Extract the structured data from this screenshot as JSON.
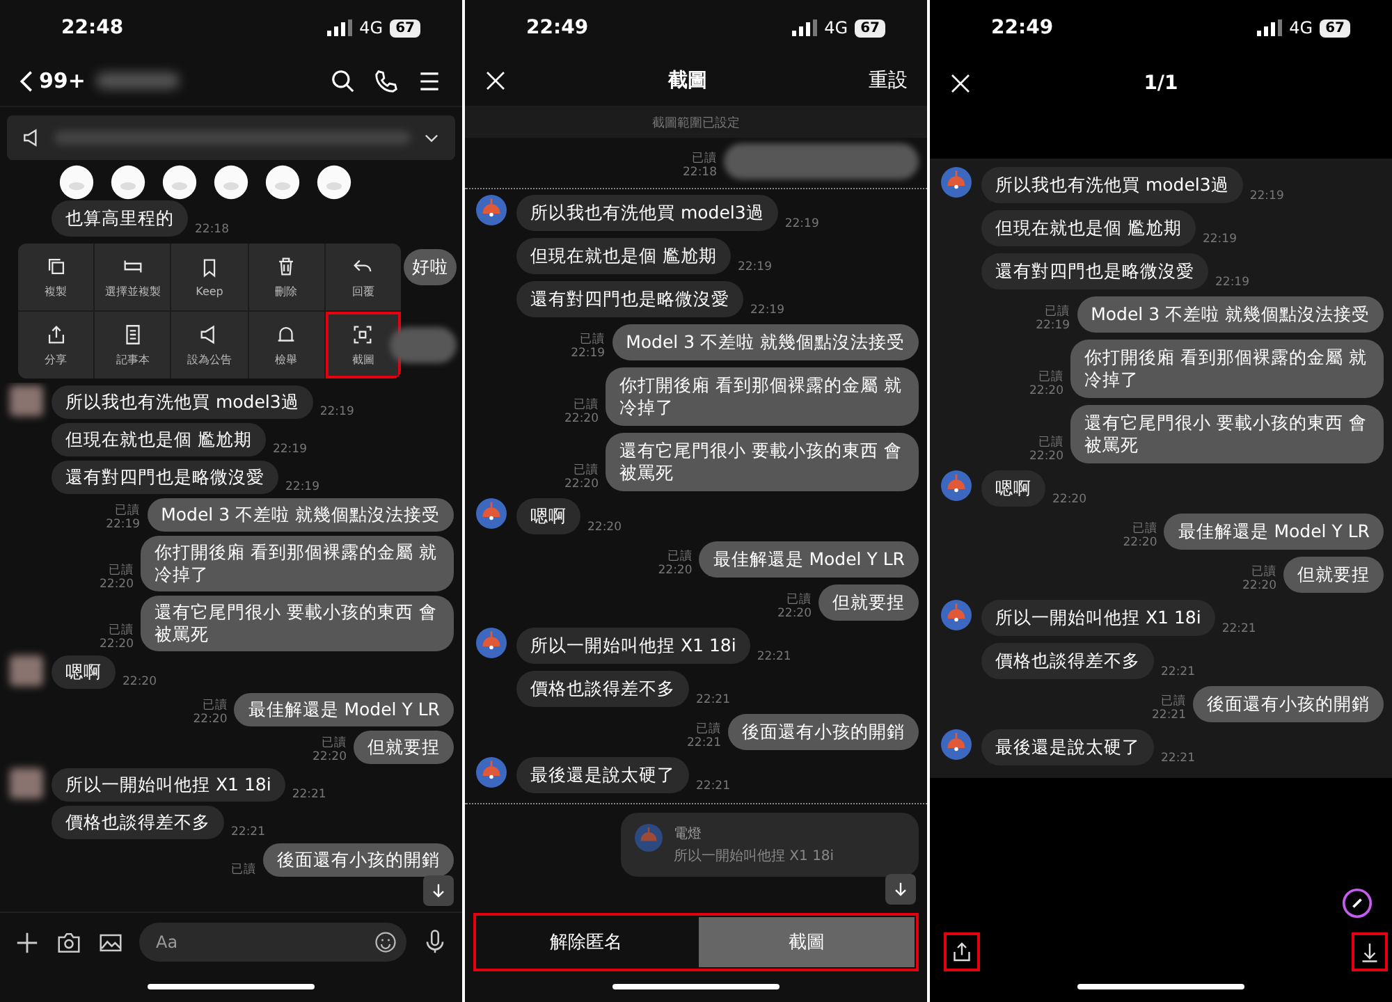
{
  "screens": [
    {
      "kind": "chat",
      "status": {
        "time": "22:48",
        "network": "4G",
        "battery": "67"
      },
      "header": {
        "unread": "99+"
      },
      "context_message": {
        "text": "也算高里程的",
        "time": "22:18"
      },
      "behind_menu": [
        {
          "kind": "out",
          "text": "好啦"
        },
        {
          "kind": "blurred"
        }
      ],
      "menu": [
        {
          "kind": "copy",
          "label": "複製",
          "highlighted": false
        },
        {
          "kind": "select_copy",
          "label": "選擇並複製",
          "highlighted": false
        },
        {
          "kind": "keep",
          "label": "Keep",
          "highlighted": false
        },
        {
          "kind": "delete",
          "label": "刪除",
          "highlighted": false
        },
        {
          "kind": "reply",
          "label": "回覆",
          "highlighted": false
        },
        {
          "kind": "share",
          "label": "分享",
          "highlighted": false
        },
        {
          "kind": "notes",
          "label": "記事本",
          "highlighted": false
        },
        {
          "kind": "announce",
          "label": "設為公告",
          "highlighted": false
        },
        {
          "kind": "report",
          "label": "檢舉",
          "highlighted": false
        },
        {
          "kind": "capture",
          "label": "截圖",
          "highlighted": true
        }
      ],
      "messages": [
        {
          "kind": "in",
          "avatar": true,
          "text": "所以我也有洗他買 model3過",
          "time": "22:19"
        },
        {
          "kind": "in",
          "text": "但現在就也是個 尷尬期",
          "time": "22:19"
        },
        {
          "kind": "in",
          "text": "還有對四門也是略微沒愛",
          "time": "22:19"
        },
        {
          "kind": "out",
          "text": "Model 3 不差啦 就幾個點沒法接受",
          "read": "已讀",
          "time": "22:19"
        },
        {
          "kind": "out",
          "text": "你打開後廂 看到那個裸露的金屬 就冷掉了",
          "read": "已讀",
          "time": "22:20"
        },
        {
          "kind": "out",
          "text": "還有它尾門很小 要載小孩的東西 會被罵死",
          "read": "已讀",
          "time": "22:20"
        },
        {
          "kind": "in",
          "avatar": true,
          "text": "嗯啊",
          "time": "22:20"
        },
        {
          "kind": "out",
          "text": "最佳解還是 Model Y LR",
          "read": "已讀",
          "time": "22:20"
        },
        {
          "kind": "out",
          "text": "但就要捏",
          "read": "已讀",
          "time": "22:20"
        },
        {
          "kind": "in",
          "avatar": true,
          "text": "所以一開始叫他捏 X1 18i",
          "time": "22:21"
        },
        {
          "kind": "in",
          "text": "價格也談得差不多",
          "time": "22:21"
        },
        {
          "kind": "out",
          "text": "後面還有小孩的開銷",
          "read": "已讀"
        }
      ],
      "input": {
        "placeholder": "Aa"
      }
    },
    {
      "kind": "capture",
      "status": {
        "time": "22:49",
        "network": "4G",
        "battery": "67"
      },
      "header": {
        "title": "截圖",
        "action": "重設"
      },
      "notice": "截圖範圍已設定",
      "pre_messages": [
        {
          "kind": "blurred",
          "read": "已讀",
          "time": "22:18"
        }
      ],
      "messages": [
        {
          "kind": "in",
          "avatar": true,
          "text": "所以我也有洗他買 model3過",
          "time": "22:19"
        },
        {
          "kind": "in",
          "text": "但現在就也是個 尷尬期",
          "time": "22:19"
        },
        {
          "kind": "in",
          "text": "還有對四門也是略微沒愛",
          "time": "22:19"
        },
        {
          "kind": "out",
          "text": "Model 3 不差啦 就幾個點沒法接受",
          "read": "已讀",
          "time": "22:19"
        },
        {
          "kind": "out",
          "text": "你打開後廂 看到那個裸露的金屬 就冷掉了",
          "read": "已讀",
          "time": "22:20"
        },
        {
          "kind": "out",
          "text": "還有它尾門很小 要載小孩的東西 會被罵死",
          "read": "已讀",
          "time": "22:20"
        },
        {
          "kind": "in",
          "avatar": true,
          "text": "嗯啊",
          "time": "22:20"
        },
        {
          "kind": "out",
          "text": "最佳解還是 Model Y LR",
          "read": "已讀",
          "time": "22:20"
        },
        {
          "kind": "out",
          "text": "但就要捏",
          "read": "已讀",
          "time": "22:20"
        },
        {
          "kind": "in",
          "avatar": true,
          "text": "所以一開始叫他捏 X1 18i",
          "time": "22:21"
        },
        {
          "kind": "in",
          "text": "價格也談得差不多",
          "time": "22:21"
        },
        {
          "kind": "out",
          "text": "後面還有小孩的開銷",
          "read": "已讀",
          "time": "22:21"
        },
        {
          "kind": "in",
          "avatar": true,
          "text": "最後還是說太硬了",
          "time": "22:21"
        }
      ],
      "reply_card": {
        "name": "電燈",
        "quote": "所以一開始叫他捏 X1 18i"
      },
      "buttons_highlighted": true,
      "buttons": [
        {
          "label": "解除匿名",
          "selected": false
        },
        {
          "label": "截圖",
          "selected": true
        }
      ]
    },
    {
      "kind": "preview",
      "status": {
        "time": "22:49",
        "network": "4G",
        "battery": "67"
      },
      "header": {
        "title": "1/1"
      },
      "messages": [
        {
          "kind": "in",
          "avatar": true,
          "text": "所以我也有洗他買 model3過",
          "time": "22:19"
        },
        {
          "kind": "in",
          "text": "但現在就也是個 尷尬期",
          "time": "22:19"
        },
        {
          "kind": "in",
          "text": "還有對四門也是略微沒愛",
          "time": "22:19"
        },
        {
          "kind": "out",
          "text": "Model 3 不差啦 就幾個點沒法接受",
          "read": "已讀",
          "time": "22:19"
        },
        {
          "kind": "out",
          "text": "你打開後廂 看到那個裸露的金屬 就冷掉了",
          "read": "已讀",
          "time": "22:20"
        },
        {
          "kind": "out",
          "text": "還有它尾門很小 要載小孩的東西 會被罵死",
          "read": "已讀",
          "time": "22:20"
        },
        {
          "kind": "in",
          "avatar": true,
          "text": "嗯啊",
          "time": "22:20"
        },
        {
          "kind": "out",
          "text": "最佳解還是 Model Y LR",
          "read": "已讀",
          "time": "22:20"
        },
        {
          "kind": "out",
          "text": "但就要捏",
          "read": "已讀",
          "time": "22:20"
        },
        {
          "kind": "in",
          "avatar": true,
          "text": "所以一開始叫他捏 X1 18i",
          "time": "22:21"
        },
        {
          "kind": "in",
          "text": "價格也談得差不多",
          "time": "22:21"
        },
        {
          "kind": "out",
          "text": "後面還有小孩的開銷",
          "read": "已讀",
          "time": "22:21"
        },
        {
          "kind": "in",
          "avatar": true,
          "text": "最後還是說太硬了",
          "time": "22:21"
        }
      ],
      "toolbar": [
        {
          "kind": "share",
          "highlighted": true
        },
        {
          "kind": "download",
          "highlighted": true
        }
      ]
    }
  ]
}
